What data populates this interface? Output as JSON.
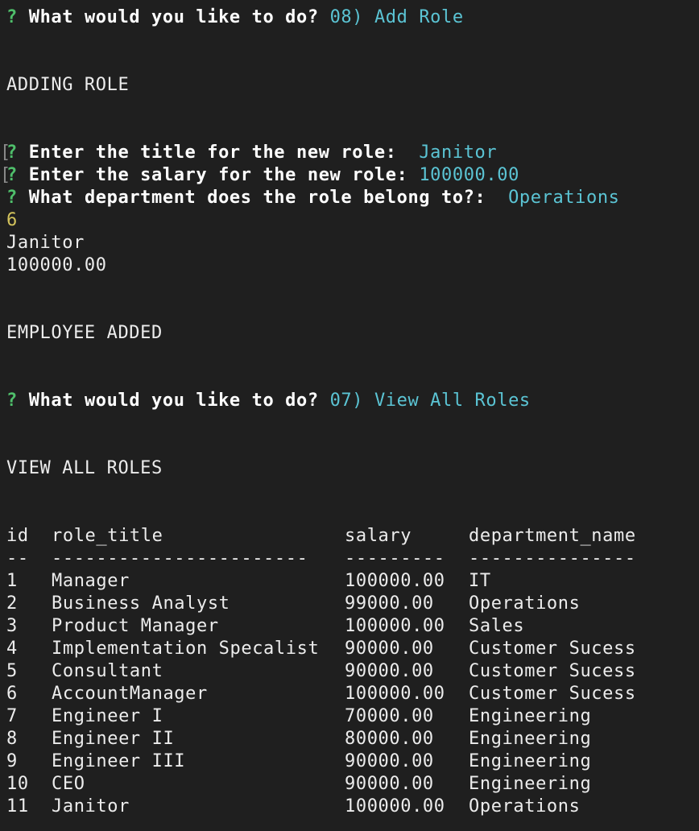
{
  "prompt_1": {
    "marker": "?",
    "question": "What would you like to do?",
    "answer": "08) Add Role"
  },
  "heading_adding": "ADDING ROLE",
  "role_prompts": [
    {
      "marker": "?",
      "question": "Enter the title for the new role:",
      "answer": " Janitor"
    },
    {
      "marker": "?",
      "question": "Enter the salary for the new role:",
      "answer": "100000.00"
    },
    {
      "marker": "?",
      "question": "What department does the role belong to?:",
      "answer": " Operations"
    }
  ],
  "echo": {
    "department_id": "6",
    "title": "Janitor",
    "salary": "100000.00"
  },
  "heading_added": "EMPLOYEE ADDED",
  "prompt_2": {
    "marker": "?",
    "question": "What would you like to do?",
    "answer": "07) View All Roles"
  },
  "heading_view": "VIEW ALL ROLES",
  "table": {
    "headers": [
      "id",
      "role_title",
      "salary",
      "department_name"
    ],
    "separators": [
      "--",
      "-----------------------",
      "---------",
      "---------------"
    ],
    "rows": [
      [
        "1",
        "Manager",
        "100000.00",
        "IT"
      ],
      [
        "2",
        "Business Analyst",
        "99000.00",
        "Operations"
      ],
      [
        "3",
        "Product Manager",
        "100000.00",
        "Sales"
      ],
      [
        "4",
        "Implementation Specalist",
        "90000.00",
        "Customer Sucess"
      ],
      [
        "5",
        "Consultant",
        "90000.00",
        "Customer Sucess"
      ],
      [
        "6",
        "AccountManager",
        "100000.00",
        "Customer Sucess"
      ],
      [
        "7",
        "Engineer I",
        "70000.00",
        "Engineering"
      ],
      [
        "8",
        "Engineer II",
        "80000.00",
        "Engineering"
      ],
      [
        "9",
        "Engineer III",
        "90000.00",
        "Engineering"
      ],
      [
        "10",
        "CEO",
        "90000.00",
        "Engineering"
      ],
      [
        "11",
        "Janitor",
        "100000.00",
        "Operations"
      ]
    ]
  },
  "colors": {
    "background": "#1f1f1f",
    "prompt_marker": "#4fbf6b",
    "answer": "#5bc4d4",
    "number": "#d3c35c",
    "text": "#ececec"
  }
}
